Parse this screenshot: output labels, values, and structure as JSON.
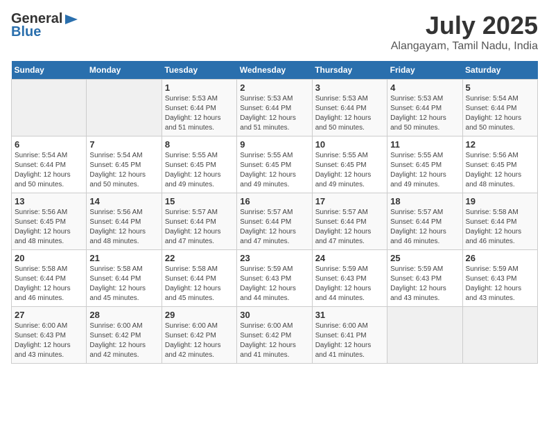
{
  "header": {
    "logo_general": "General",
    "logo_blue": "Blue",
    "title": "July 2025",
    "location": "Alangayam, Tamil Nadu, India"
  },
  "weekdays": [
    "Sunday",
    "Monday",
    "Tuesday",
    "Wednesday",
    "Thursday",
    "Friday",
    "Saturday"
  ],
  "weeks": [
    [
      {
        "day": "",
        "text": ""
      },
      {
        "day": "",
        "text": ""
      },
      {
        "day": "1",
        "text": "Sunrise: 5:53 AM\nSunset: 6:44 PM\nDaylight: 12 hours and 51 minutes."
      },
      {
        "day": "2",
        "text": "Sunrise: 5:53 AM\nSunset: 6:44 PM\nDaylight: 12 hours and 51 minutes."
      },
      {
        "day": "3",
        "text": "Sunrise: 5:53 AM\nSunset: 6:44 PM\nDaylight: 12 hours and 50 minutes."
      },
      {
        "day": "4",
        "text": "Sunrise: 5:53 AM\nSunset: 6:44 PM\nDaylight: 12 hours and 50 minutes."
      },
      {
        "day": "5",
        "text": "Sunrise: 5:54 AM\nSunset: 6:44 PM\nDaylight: 12 hours and 50 minutes."
      }
    ],
    [
      {
        "day": "6",
        "text": "Sunrise: 5:54 AM\nSunset: 6:44 PM\nDaylight: 12 hours and 50 minutes."
      },
      {
        "day": "7",
        "text": "Sunrise: 5:54 AM\nSunset: 6:45 PM\nDaylight: 12 hours and 50 minutes."
      },
      {
        "day": "8",
        "text": "Sunrise: 5:55 AM\nSunset: 6:45 PM\nDaylight: 12 hours and 49 minutes."
      },
      {
        "day": "9",
        "text": "Sunrise: 5:55 AM\nSunset: 6:45 PM\nDaylight: 12 hours and 49 minutes."
      },
      {
        "day": "10",
        "text": "Sunrise: 5:55 AM\nSunset: 6:45 PM\nDaylight: 12 hours and 49 minutes."
      },
      {
        "day": "11",
        "text": "Sunrise: 5:55 AM\nSunset: 6:45 PM\nDaylight: 12 hours and 49 minutes."
      },
      {
        "day": "12",
        "text": "Sunrise: 5:56 AM\nSunset: 6:45 PM\nDaylight: 12 hours and 48 minutes."
      }
    ],
    [
      {
        "day": "13",
        "text": "Sunrise: 5:56 AM\nSunset: 6:45 PM\nDaylight: 12 hours and 48 minutes."
      },
      {
        "day": "14",
        "text": "Sunrise: 5:56 AM\nSunset: 6:44 PM\nDaylight: 12 hours and 48 minutes."
      },
      {
        "day": "15",
        "text": "Sunrise: 5:57 AM\nSunset: 6:44 PM\nDaylight: 12 hours and 47 minutes."
      },
      {
        "day": "16",
        "text": "Sunrise: 5:57 AM\nSunset: 6:44 PM\nDaylight: 12 hours and 47 minutes."
      },
      {
        "day": "17",
        "text": "Sunrise: 5:57 AM\nSunset: 6:44 PM\nDaylight: 12 hours and 47 minutes."
      },
      {
        "day": "18",
        "text": "Sunrise: 5:57 AM\nSunset: 6:44 PM\nDaylight: 12 hours and 46 minutes."
      },
      {
        "day": "19",
        "text": "Sunrise: 5:58 AM\nSunset: 6:44 PM\nDaylight: 12 hours and 46 minutes."
      }
    ],
    [
      {
        "day": "20",
        "text": "Sunrise: 5:58 AM\nSunset: 6:44 PM\nDaylight: 12 hours and 46 minutes."
      },
      {
        "day": "21",
        "text": "Sunrise: 5:58 AM\nSunset: 6:44 PM\nDaylight: 12 hours and 45 minutes."
      },
      {
        "day": "22",
        "text": "Sunrise: 5:58 AM\nSunset: 6:44 PM\nDaylight: 12 hours and 45 minutes."
      },
      {
        "day": "23",
        "text": "Sunrise: 5:59 AM\nSunset: 6:43 PM\nDaylight: 12 hours and 44 minutes."
      },
      {
        "day": "24",
        "text": "Sunrise: 5:59 AM\nSunset: 6:43 PM\nDaylight: 12 hours and 44 minutes."
      },
      {
        "day": "25",
        "text": "Sunrise: 5:59 AM\nSunset: 6:43 PM\nDaylight: 12 hours and 43 minutes."
      },
      {
        "day": "26",
        "text": "Sunrise: 5:59 AM\nSunset: 6:43 PM\nDaylight: 12 hours and 43 minutes."
      }
    ],
    [
      {
        "day": "27",
        "text": "Sunrise: 6:00 AM\nSunset: 6:43 PM\nDaylight: 12 hours and 43 minutes."
      },
      {
        "day": "28",
        "text": "Sunrise: 6:00 AM\nSunset: 6:42 PM\nDaylight: 12 hours and 42 minutes."
      },
      {
        "day": "29",
        "text": "Sunrise: 6:00 AM\nSunset: 6:42 PM\nDaylight: 12 hours and 42 minutes."
      },
      {
        "day": "30",
        "text": "Sunrise: 6:00 AM\nSunset: 6:42 PM\nDaylight: 12 hours and 41 minutes."
      },
      {
        "day": "31",
        "text": "Sunrise: 6:00 AM\nSunset: 6:41 PM\nDaylight: 12 hours and 41 minutes."
      },
      {
        "day": "",
        "text": ""
      },
      {
        "day": "",
        "text": ""
      }
    ]
  ]
}
